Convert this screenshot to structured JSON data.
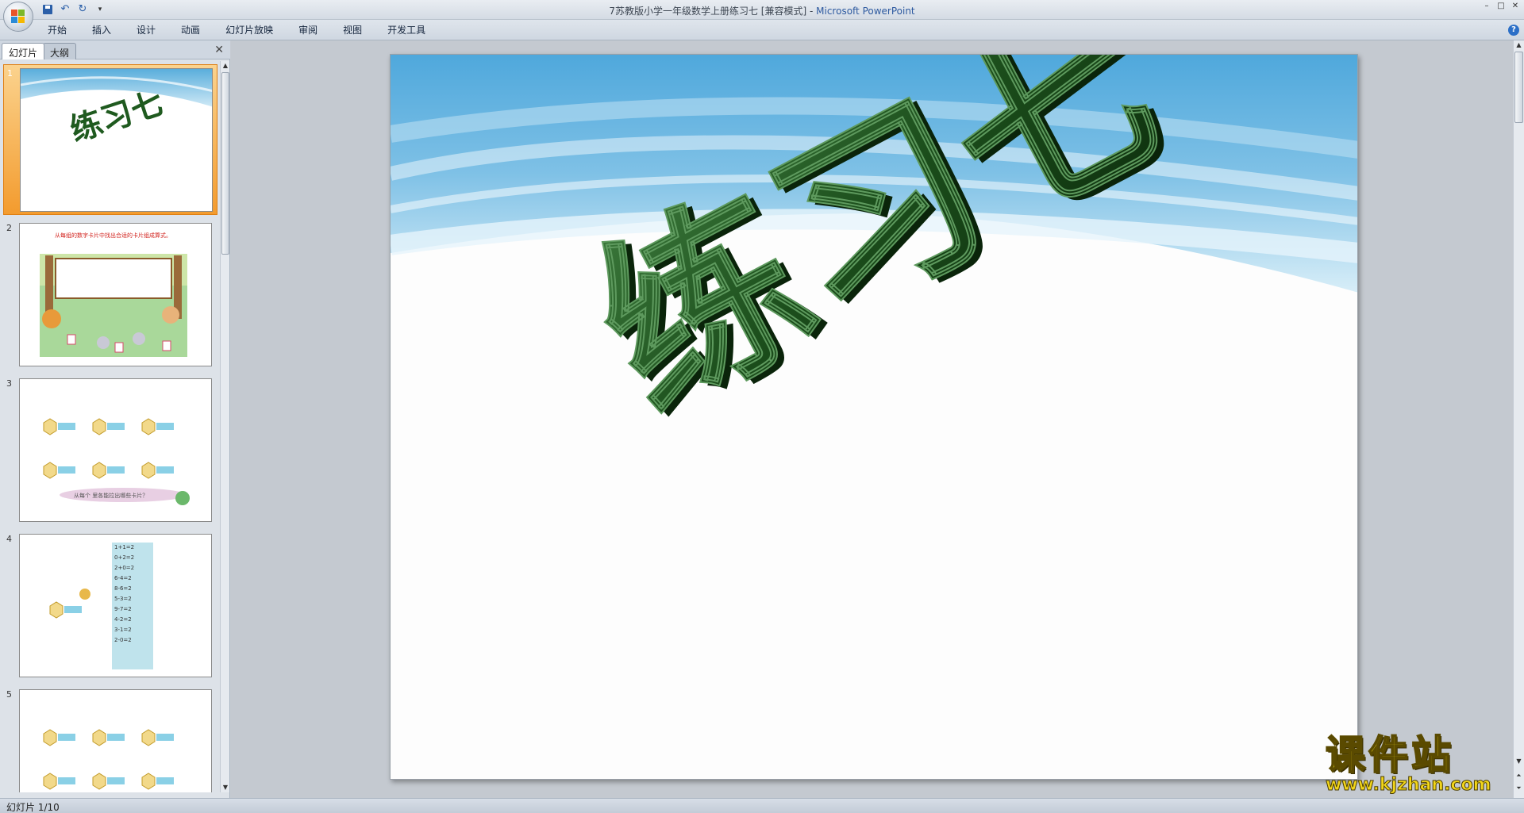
{
  "window": {
    "title_doc": "7苏教版小学一年级数学上册练习七 [兼容模式]",
    "title_sep": " - ",
    "title_app": "Microsoft PowerPoint",
    "controls": [
      "–",
      "□",
      "✕"
    ]
  },
  "quick_access": {
    "more": "▾"
  },
  "ribbon": {
    "tabs": [
      "开始",
      "插入",
      "设计",
      "动画",
      "幻灯片放映",
      "审阅",
      "视图",
      "开发工具"
    ],
    "help": "?"
  },
  "left_panel": {
    "tabs": [
      "幻灯片",
      "大纲"
    ],
    "close": "✕",
    "slides": [
      {
        "num": "1"
      },
      {
        "num": "2",
        "caption": "从每组的数字卡片中找出合适的卡片组成算式。"
      },
      {
        "num": "3",
        "caption": "从每个 里各能拉出哪些卡片？"
      },
      {
        "num": "4",
        "list": [
          "1+1=2",
          "0+2=2",
          "2+0=2",
          "6-4=2",
          "8-6=2",
          "5-3=2",
          "9-7=2",
          "4-2=2",
          "3-1=2",
          "2-0=2"
        ]
      },
      {
        "num": "5"
      }
    ]
  },
  "slide": {
    "title": "练习七"
  },
  "status": {
    "text": "幻灯片 1/10"
  },
  "watermark": {
    "cn": "课件站",
    "url": "www.kjzhan.com"
  },
  "colors": {
    "accent": "#2e5aa0",
    "selection": "#f39b2e",
    "title3d": "#1f5a1f",
    "sky": "#6fb7e0"
  }
}
